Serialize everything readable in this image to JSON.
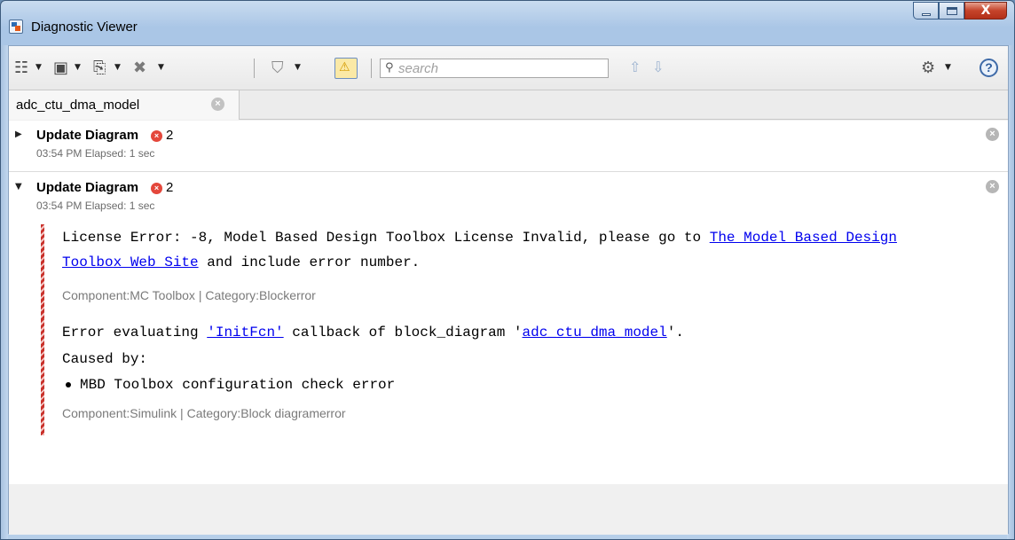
{
  "window": {
    "title": "Diagnostic Viewer",
    "minimize_glyph": "",
    "close_glyph": "X"
  },
  "toolbar": {
    "view_icon": "view-list-icon",
    "save_icon": "save-icon",
    "copy_icon": "copy-icon",
    "clear_icon": "clear-icon",
    "filter_icon": "filter-icon",
    "severity_icon": "warning-toggle-icon",
    "search_placeholder": "search",
    "prev_icon": "up-arrow-icon",
    "next_icon": "down-arrow-icon",
    "settings_icon": "gear-icon",
    "help_label": "?"
  },
  "tabs": [
    {
      "label": "adc_ctu_dma_model"
    }
  ],
  "entries": [
    {
      "title": "Update Diagram",
      "error_count": "2",
      "meta": "03:54 PM  Elapsed: 1 sec",
      "expanded": false
    },
    {
      "title": "Update Diagram",
      "error_count": "2",
      "meta": "03:54 PM  Elapsed: 1 sec",
      "expanded": true,
      "messages": [
        {
          "line1_prefix": "License Error: -8, Model Based Design Toolbox License Invalid, please go to ",
          "line1_link": "The Model Based Design",
          "line2_link": "Toolbox Web Site",
          "line2_suffix": " and include error number.",
          "component": "Component:MC Toolbox | Category:Blockerror"
        },
        {
          "line1_prefix": "Error evaluating ",
          "line1_link": "'InitFcn'",
          "line1_mid": " callback of block_diagram '",
          "line1_link2": "adc_ctu_dma_model",
          "line1_suffix": "'.",
          "caused_by": "Caused by:",
          "bullet": "MBD Toolbox configuration check error",
          "component": "Component:Simulink | Category:Block diagramerror"
        }
      ]
    }
  ],
  "colors": {
    "error": "#e4473b",
    "link": "#0000ee",
    "accent": "#3e6aa8"
  }
}
